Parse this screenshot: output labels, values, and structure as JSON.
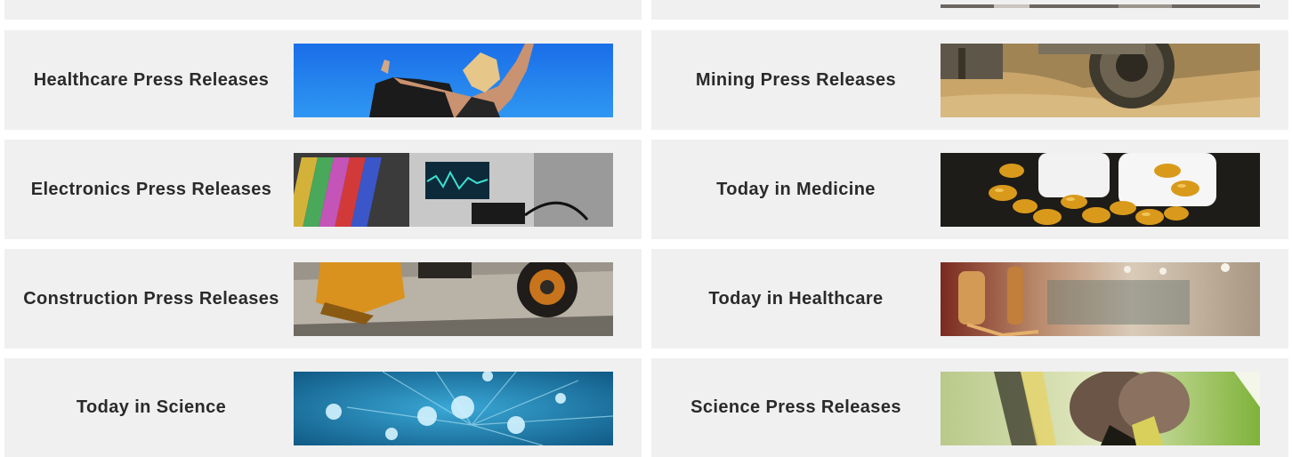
{
  "cards": {
    "healthcare_press": {
      "label": "Healthcare Press Releases",
      "image": "woman-reaching-sky-photo"
    },
    "mining_press": {
      "label": "Mining Press Releases",
      "image": "mining-excavator-photo"
    },
    "electronics_press": {
      "label": "Electronics Press Releases",
      "image": "oscilloscope-electronics-photo"
    },
    "today_medicine": {
      "label": "Today in Medicine",
      "image": "capsules-bottle-photo"
    },
    "construction_press": {
      "label": "Construction Press Releases",
      "image": "construction-loader-photo"
    },
    "today_healthcare": {
      "label": "Today in Healthcare",
      "image": "hospital-corridor-photo"
    },
    "today_science": {
      "label": "Today in Science",
      "image": "water-droplets-photo"
    },
    "science_press": {
      "label": "Science Press Releases",
      "image": "insect-closeup-photo"
    }
  },
  "colors": {
    "card_bg": "#f0f0f0",
    "text": "#2a2a2a",
    "page_bg": "#ffffff"
  }
}
